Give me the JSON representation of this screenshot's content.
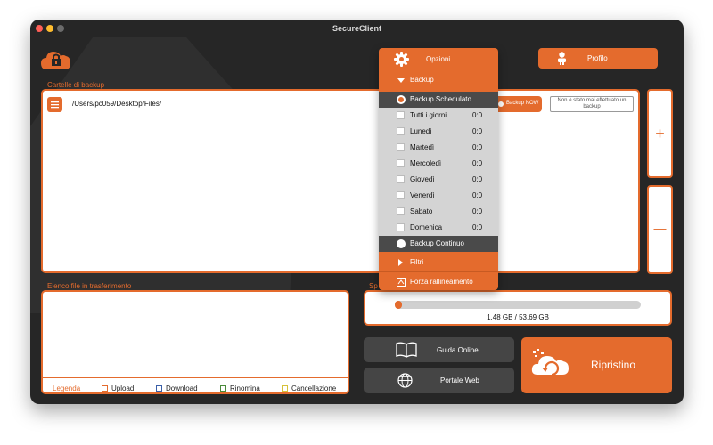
{
  "window": {
    "title": "SecureClient"
  },
  "colors": {
    "accent": "#e46b2d",
    "background": "#262626",
    "button_dark": "#454545"
  },
  "header": {
    "profile_label": "Profilo",
    "logo_icon": "cloud-lock-icon"
  },
  "backup_folders": {
    "label": "Cartelle di backup",
    "items": [
      {
        "path": "/Users/pc059/Desktop/Files/",
        "backup_now_label": "Backup NOW",
        "status": "Non è stato mai effettuato un backup"
      }
    ]
  },
  "side_buttons": {
    "add": "+",
    "remove": "—"
  },
  "transfers": {
    "label": "Elenco file in trasferimento"
  },
  "legend": {
    "title": "Legenda",
    "items": [
      {
        "label": "Upload",
        "color": "#e46b2d"
      },
      {
        "label": "Download",
        "color": "#3a5fa8"
      },
      {
        "label": "Rinomina",
        "color": "#4a8a3a"
      },
      {
        "label": "Cancellazione",
        "color": "#d6c23a"
      }
    ]
  },
  "storage": {
    "label_prefix": "Sp",
    "used_text": "1,48 GB / 53,69 GB",
    "used_fraction": 0.028
  },
  "buttons": {
    "guide": "Guida Online",
    "portal": "Portale Web",
    "restore": "Ripristino"
  },
  "menu": {
    "title": "Opzioni",
    "backup_header": "Backup",
    "scheduled": "Backup Schedulato",
    "days": [
      {
        "label": "Tutti i giorni",
        "time": "0:0"
      },
      {
        "label": "Lunedì",
        "time": "0:0"
      },
      {
        "label": "Martedì",
        "time": "0:0"
      },
      {
        "label": "Mercoledì",
        "time": "0:0"
      },
      {
        "label": "Giovedì",
        "time": "0:0"
      },
      {
        "label": "Venerdì",
        "time": "0:0"
      },
      {
        "label": "Sabato",
        "time": "0:0"
      },
      {
        "label": "Domenica",
        "time": "0:0"
      }
    ],
    "continuous": "Backup Continuo",
    "filters": "Filtri",
    "throttle": "Forza rallineamento"
  }
}
